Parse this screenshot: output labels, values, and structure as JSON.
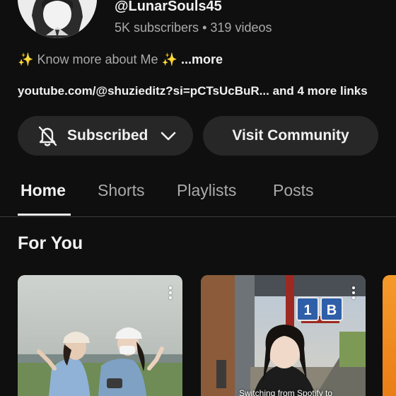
{
  "channel": {
    "handle": "@LunarSouls45",
    "subscribers": "5K subscribers",
    "separator": "•",
    "videos": "319 videos",
    "about_spark": "✨",
    "about_text": "Know more about Me",
    "about_more": "...more",
    "link_url": "youtube.com/@shuzieditz?si=pCTsUcBuR...",
    "link_more": "and 4 more links"
  },
  "buttons": {
    "subscribed_label": "Subscribed",
    "community_label": "Visit Community"
  },
  "tabs": [
    {
      "label": "Home",
      "active": true
    },
    {
      "label": "Shorts",
      "active": false
    },
    {
      "label": "Playlists",
      "active": false
    },
    {
      "label": "Posts",
      "active": false
    }
  ],
  "section": {
    "title": "For You"
  },
  "shorts": [
    {
      "caption": ""
    },
    {
      "caption": "Switching from Spotify to",
      "platform_sign_1": "1",
      "platform_sign_2": "B"
    }
  ],
  "colors": {
    "background": "#0f0f0f",
    "button_bg": "#272727",
    "text_primary": "#f1f1f1",
    "text_secondary": "#aaaaaa",
    "sparkle": "#f4c542"
  }
}
